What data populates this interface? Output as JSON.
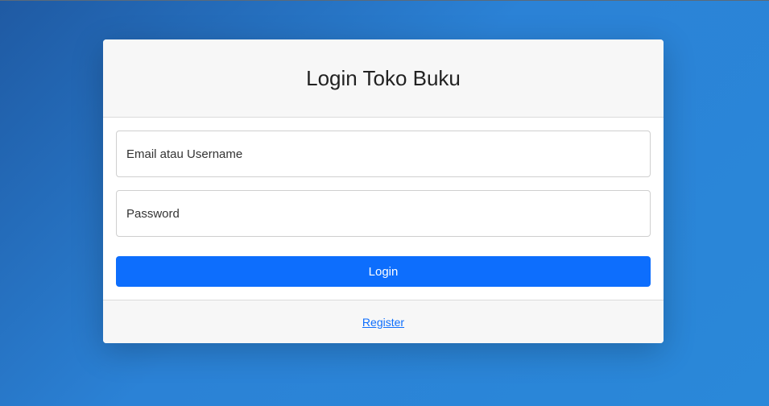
{
  "login_card": {
    "title": "Login Toko Buku",
    "fields": {
      "email_placeholder": "Email atau Username",
      "email_value": "",
      "password_placeholder": "Password",
      "password_value": ""
    },
    "login_button_label": "Login",
    "register_link_label": "Register"
  },
  "colors": {
    "primary": "#0d6efd",
    "background_gradient_start": "#1f5aa3",
    "background_gradient_end": "#2a88d9",
    "card_header_bg": "#f7f7f7"
  }
}
